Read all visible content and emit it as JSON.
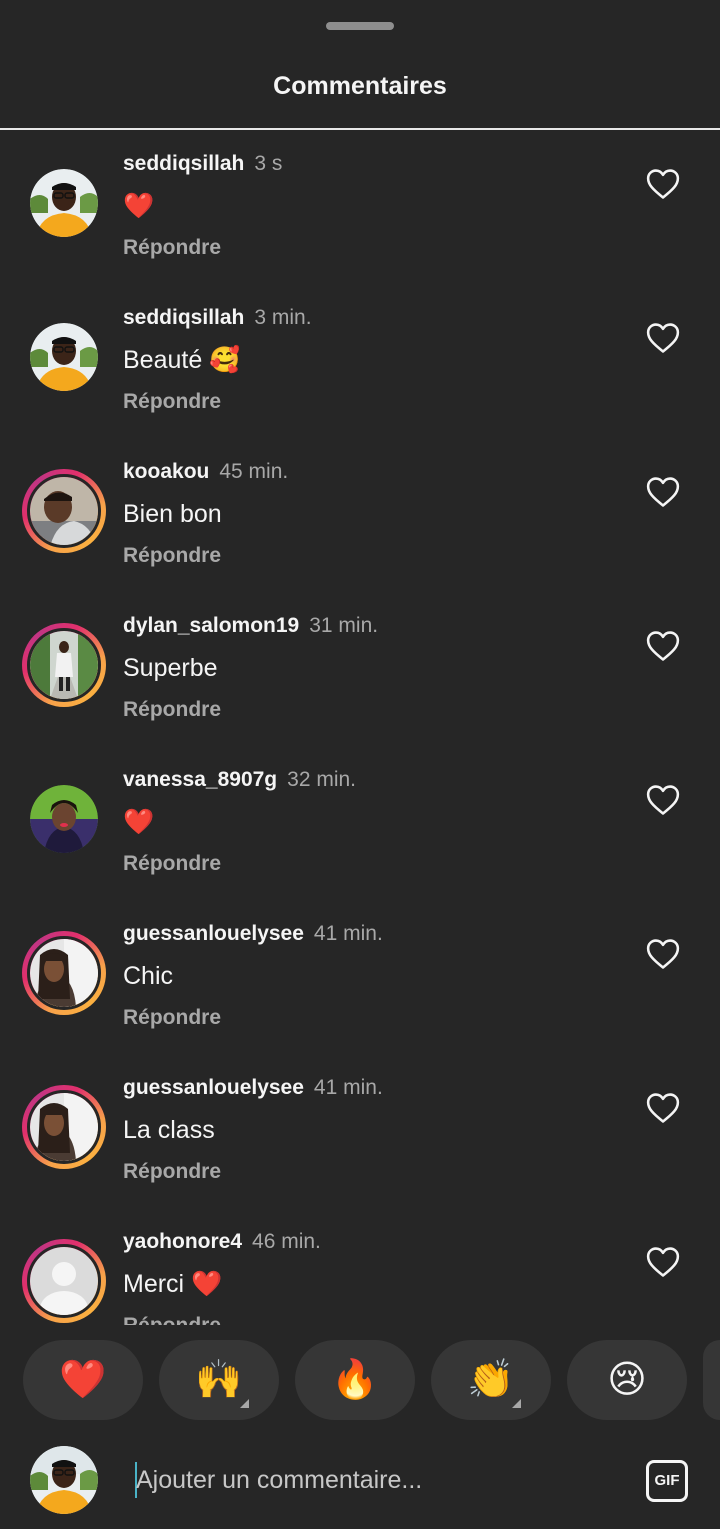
{
  "sheet": {
    "title": "Commentaires"
  },
  "comments": [
    {
      "username": "seddiqsillah",
      "time": "3 s",
      "text": "❤️",
      "reply": "Répondre",
      "ring": false,
      "avatar": "man-orange"
    },
    {
      "username": "seddiqsillah",
      "time": "3 min.",
      "text": "Beauté 🥰",
      "reply": "Répondre",
      "ring": false,
      "avatar": "man-orange"
    },
    {
      "username": "kooakou",
      "time": "45 min.",
      "text": "Bien bon",
      "reply": "Répondre",
      "ring": true,
      "avatar": "man-selfie"
    },
    {
      "username": "dylan_salomon19",
      "time": "31 min.",
      "text": "Superbe",
      "reply": "Répondre",
      "ring": true,
      "avatar": "person-walking"
    },
    {
      "username": "vanessa_8907g",
      "time": "32 min.",
      "text": "❤️",
      "reply": "Répondre",
      "ring": false,
      "avatar": "woman-green"
    },
    {
      "username": "guessanlouelysee",
      "time": "41 min.",
      "text": "Chic",
      "reply": "Répondre",
      "ring": true,
      "avatar": "woman-braids"
    },
    {
      "username": "guessanlouelysee",
      "time": "41 min.",
      "text": "La class",
      "reply": "Répondre",
      "ring": true,
      "avatar": "woman-braids"
    },
    {
      "username": "yaohonore4",
      "time": "46 min.",
      "text": "Merci ❤️",
      "reply": "Répondre",
      "ring": true,
      "avatar": "default-silhouette"
    }
  ],
  "reactions": [
    {
      "emoji": "❤️",
      "has_variants": false
    },
    {
      "emoji": "🙌",
      "has_variants": true
    },
    {
      "emoji": "🔥",
      "has_variants": false
    },
    {
      "emoji": "👏",
      "has_variants": true
    },
    {
      "emoji": "😢",
      "has_variants": false
    }
  ],
  "composer": {
    "placeholder": "Ajouter un commentaire...",
    "gif_label": "GIF"
  },
  "colors": {
    "background": "#262626",
    "text_primary": "#f5f5f5",
    "text_secondary": "#a8a8a8",
    "like_red": "#ed4956",
    "story_ring": [
      "#f7a24a",
      "#e1306c",
      "#c13584"
    ]
  }
}
